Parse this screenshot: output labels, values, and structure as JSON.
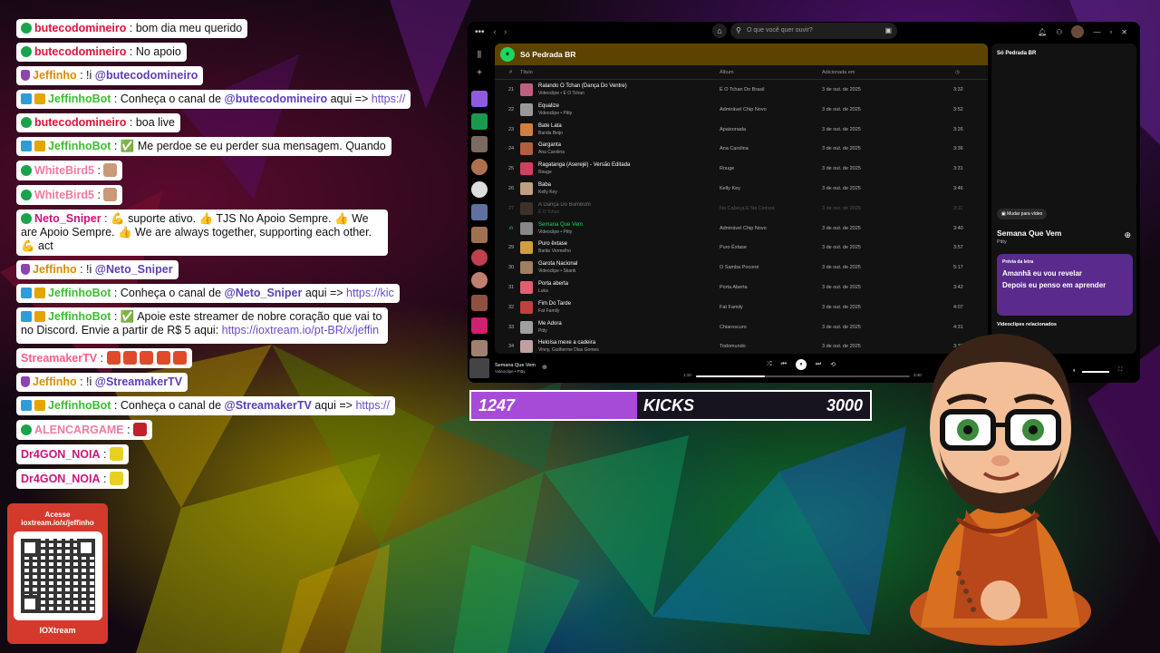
{
  "chat": [
    {
      "badges": [
        "verified"
      ],
      "user": "butecodomineiro",
      "user_color": "#e0123a",
      "parts": [
        {
          "t": "text",
          "v": " : bom dia meu querido"
        }
      ]
    },
    {
      "badges": [
        "verified"
      ],
      "user": "butecodomineiro",
      "user_color": "#e0123a",
      "parts": [
        {
          "t": "text",
          "v": " : No apoio"
        }
      ]
    },
    {
      "badges": [
        "sub"
      ],
      "user": "Jeffinho",
      "user_color": "#e08a00",
      "parts": [
        {
          "t": "text",
          "v": " : !i "
        },
        {
          "t": "mention",
          "v": "@butecodomineiro"
        }
      ]
    },
    {
      "badges": [
        "bot",
        "bot2"
      ],
      "user": "JeffinhoBot",
      "user_color": "#3bbf2f",
      "parts": [
        {
          "t": "text",
          "v": " : Conheça o canal de "
        },
        {
          "t": "mention",
          "v": "@butecodomineiro"
        },
        {
          "t": "text",
          "v": " aqui => "
        },
        {
          "t": "link",
          "v": "https://"
        }
      ]
    },
    {
      "badges": [
        "verified"
      ],
      "user": "butecodomineiro",
      "user_color": "#e0123a",
      "parts": [
        {
          "t": "text",
          "v": " : boa live"
        }
      ]
    },
    {
      "badges": [
        "bot",
        "bot2"
      ],
      "user": "JeffinhoBot",
      "user_color": "#3bbf2f",
      "parts": [
        {
          "t": "text",
          "v": " : ✅ Me perdoe se eu perder sua mensagem. Quando"
        }
      ]
    },
    {
      "badges": [
        "verified"
      ],
      "user": "WhiteBird5",
      "user_color": "#f07aa0",
      "parts": [
        {
          "t": "text",
          "v": " : "
        },
        {
          "t": "emoji",
          "v": "#c89a7a"
        }
      ]
    },
    {
      "badges": [
        "verified"
      ],
      "user": "WhiteBird5",
      "user_color": "#f07aa0",
      "parts": [
        {
          "t": "text",
          "v": " : "
        },
        {
          "t": "emoji",
          "v": "#c89a7a"
        }
      ]
    },
    {
      "badges": [
        "verified"
      ],
      "user": "Neto_Sniper",
      "user_color": "#d0127a",
      "multi": true,
      "parts": [
        {
          "t": "text",
          "v": " : 💪 suporte ativo. 👍 TJS No Apoio Sempre. 👍 We are Apoio Sempre. 👍 We are always together, supporting each other. 💪 act"
        }
      ]
    },
    {
      "badges": [
        "sub"
      ],
      "user": "Jeffinho",
      "user_color": "#e08a00",
      "parts": [
        {
          "t": "text",
          "v": " : !i "
        },
        {
          "t": "mention",
          "v": "@Neto_Sniper"
        }
      ]
    },
    {
      "badges": [
        "bot",
        "bot2"
      ],
      "user": "JeffinhoBot",
      "user_color": "#3bbf2f",
      "parts": [
        {
          "t": "text",
          "v": " : Conheça o canal de "
        },
        {
          "t": "mention",
          "v": "@Neto_Sniper"
        },
        {
          "t": "text",
          "v": " aqui => "
        },
        {
          "t": "link",
          "v": "https://kic"
        }
      ]
    },
    {
      "badges": [
        "bot",
        "bot2"
      ],
      "user": "JeffinhoBot",
      "user_color": "#3bbf2f",
      "multi": true,
      "parts": [
        {
          "t": "text",
          "v": " : ✅ Apoie este streamer de nobre coração que vai to no Discord. Envie a partir de R$ 5 aqui: "
        },
        {
          "t": "link",
          "v": "https://ioxtream.io/pt-BR/x/jeffin"
        }
      ]
    },
    {
      "badges": [],
      "user": "StreamakerTV",
      "user_color": "#ff5c8a",
      "parts": [
        {
          "t": "text",
          "v": " : "
        },
        {
          "t": "emoji",
          "v": "#e04a2a"
        },
        {
          "t": "text",
          "v": " "
        },
        {
          "t": "emoji",
          "v": "#e04a2a"
        },
        {
          "t": "text",
          "v": " "
        },
        {
          "t": "emoji",
          "v": "#e04a2a"
        },
        {
          "t": "text",
          "v": " "
        },
        {
          "t": "emoji",
          "v": "#e04a2a"
        },
        {
          "t": "text",
          "v": " "
        },
        {
          "t": "emoji",
          "v": "#e04a2a"
        }
      ]
    },
    {
      "badges": [
        "sub"
      ],
      "user": "Jeffinho",
      "user_color": "#e08a00",
      "parts": [
        {
          "t": "text",
          "v": " : !i "
        },
        {
          "t": "mention",
          "v": "@StreamakerTV"
        }
      ]
    },
    {
      "badges": [
        "bot",
        "bot2"
      ],
      "user": "JeffinhoBot",
      "user_color": "#3bbf2f",
      "parts": [
        {
          "t": "text",
          "v": " : Conheça o canal de "
        },
        {
          "t": "mention",
          "v": "@StreamakerTV"
        },
        {
          "t": "text",
          "v": " aqui => "
        },
        {
          "t": "link",
          "v": "https://"
        }
      ]
    },
    {
      "badges": [
        "verified"
      ],
      "user": "ALENCARGAME",
      "user_color": "#f07aa0",
      "parts": [
        {
          "t": "text",
          "v": " : "
        },
        {
          "t": "emoji",
          "v": "#c0202a"
        }
      ]
    },
    {
      "badges": [],
      "user": "Dr4GON_NOIA",
      "user_color": "#d0127a",
      "parts": [
        {
          "t": "text",
          "v": " : "
        },
        {
          "t": "emoji",
          "v": "#e8d020"
        }
      ]
    },
    {
      "badges": [],
      "user": "Dr4GON_NOIA",
      "user_color": "#d0127a",
      "parts": [
        {
          "t": "text",
          "v": " : "
        },
        {
          "t": "emoji",
          "v": "#e8d020"
        }
      ]
    }
  ],
  "qr_panel": {
    "line1": "Acesse",
    "line2": "ioxtream.io/x/jeffinho",
    "brand": "IOXtream"
  },
  "spotify": {
    "search_placeholder": "O que você quer ouvir?",
    "playlist_title": "Só Pedrada BR",
    "columns": {
      "num": "#",
      "title": "Título",
      "album": "Álbum",
      "added": "Adicionada em"
    },
    "tracks": [
      {
        "num": "21",
        "name": "Ralando O Tchan (Dança Do Ventre)",
        "artist": "Videoclipe • É O Tchan",
        "album": "É O Tchan Do Brasil",
        "date": "3 de out. de 2025",
        "dur": "3:32",
        "color": "#c06080"
      },
      {
        "num": "22",
        "name": "Equalize",
        "artist": "Videoclipe • Pitty",
        "album": "Admirável Chip Novo",
        "date": "3 de out. de 2025",
        "dur": "3:52",
        "color": "#999"
      },
      {
        "num": "23",
        "name": "Bate Lata",
        "artist": "Banda Beijo",
        "album": "Apaixonada",
        "date": "3 de out. de 2025",
        "dur": "3:26",
        "color": "#d08040"
      },
      {
        "num": "24",
        "name": "Garganta",
        "artist": "Ana Carolina",
        "album": "Ana Carolina",
        "date": "3 de out. de 2025",
        "dur": "3:36",
        "color": "#b06040"
      },
      {
        "num": "25",
        "name": "Ragatanga (Aserejé) - Versão Editada",
        "artist": "Rouge",
        "album": "Rouge",
        "date": "3 de out. de 2025",
        "dur": "3:31",
        "color": "#d04060"
      },
      {
        "num": "26",
        "name": "Baba",
        "artist": "Kelly Key",
        "album": "Kelly Key",
        "date": "3 de out. de 2025",
        "dur": "3:46",
        "color": "#c0a080"
      },
      {
        "num": "27",
        "name": "A Dança Do Bumbum",
        "artist": "É O Tchan",
        "album": "Na Cabeça E Na Cintura",
        "date": "3 de out. de 2025",
        "dur": "3:11",
        "color": "#806050",
        "dim": true
      },
      {
        "num": "28",
        "name": "Semana Que Vem",
        "artist": "Videoclipe • Pitty",
        "album": "Admirável Chip Novo",
        "date": "3 de out. de 2025",
        "dur": "3:40",
        "color": "#888",
        "active": true
      },
      {
        "num": "29",
        "name": "Puro êxtase",
        "artist": "Barão Vermelho",
        "album": "Puro Êxtase",
        "date": "3 de out. de 2025",
        "dur": "3:57",
        "color": "#d0a040"
      },
      {
        "num": "30",
        "name": "Garota Nacional",
        "artist": "Videoclipe • Skank",
        "album": "O Samba Poconé",
        "date": "3 de out. de 2025",
        "dur": "5:17",
        "color": "#a08060"
      },
      {
        "num": "31",
        "name": "Porta aberta",
        "artist": "Luka",
        "album": "Porta Aberta",
        "date": "3 de out. de 2025",
        "dur": "3:42",
        "color": "#e06070"
      },
      {
        "num": "32",
        "name": "Fim Do Tarde",
        "artist": "Fat Family",
        "album": "Fat Family",
        "date": "3 de out. de 2025",
        "dur": "4:07",
        "color": "#c04040"
      },
      {
        "num": "33",
        "name": "Me Adora",
        "artist": "Pitty",
        "album": "Chiaroscuro",
        "date": "3 de out. de 2025",
        "dur": "4:31",
        "color": "#a0a0a0"
      },
      {
        "num": "34",
        "name": "Heloísa mexe a cadeira",
        "artist": "Vinny, Guilherme Dias Gomes",
        "album": "Todomundo",
        "date": "3 de out. de 2025",
        "dur": "3:30",
        "color": "#c0a0a0"
      }
    ],
    "right_panel": {
      "title": "Só Pedrada BR",
      "video_button": "Mudar para vídeo",
      "song": "Semana Que Vem",
      "artist": "Pitty",
      "lyrics_header": "Prévia da letra",
      "lyric1": "Amanhã eu vou revelar",
      "lyric2": "Depois eu penso em aprender",
      "related": "Videoclipes relacionados"
    },
    "player": {
      "title": "Semana Que Vem",
      "sub": "Videoclipe • Pitty",
      "time_elapsed": "1:10",
      "time_total": "3:40",
      "progress": 0.32
    }
  },
  "kicks": {
    "current": "1247",
    "label": "KICKS",
    "goal": "3000",
    "progress": 0.4157
  },
  "colors": {
    "spotify_green": "#1ed760",
    "kicks_fill": "#a64bd8",
    "qr_panel": "#d43a2c"
  }
}
